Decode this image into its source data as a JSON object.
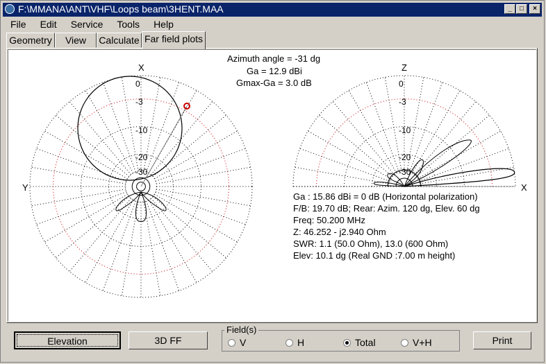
{
  "window": {
    "title": "F:\\MMANA\\ANT\\VHF\\Loops beam\\3HENT.MAA",
    "min_label": "_",
    "max_label": "□",
    "close_label": "×"
  },
  "menu": [
    "File",
    "Edit",
    "Service",
    "Tools",
    "Help"
  ],
  "tabs": [
    "Geometry",
    "View",
    "Calculate",
    "Far field plots"
  ],
  "active_tab": 3,
  "header": {
    "azimuth": "Azimuth angle = -31 dg",
    "ga": "Ga = 12.9 dBi",
    "gmax": "Gmax-Ga = 3.0 dB"
  },
  "azimuth_plot": {
    "top_label": "X",
    "left_label": "Y",
    "ring_labels": [
      "0",
      "-3",
      "-10",
      "-20",
      "-30"
    ]
  },
  "elevation_plot": {
    "top_label": "Z",
    "right_label": "X",
    "ring_labels": [
      "0",
      "-3",
      "-10",
      "-20",
      "-30"
    ]
  },
  "results": [
    "Ga : 15.86 dBi = 0 dB  (Horizontal polarization)",
    "F/B: 19.70 dB; Rear: Azim. 120 dg,  Elev. 60 dg",
    "Freq: 50.200 MHz",
    "Z: 46.252 - j2.940 Ohm",
    "SWR: 1.1 (50.0 Ohm), 13.0 (600 Ohm)",
    "Elev: 10.1 dg (Real GND  :7.00 m height)"
  ],
  "buttons": {
    "elevation": "Elevation",
    "ff3d": "3D FF",
    "print": "Print"
  },
  "field_group": {
    "label": "Field(s)",
    "options": [
      "V",
      "H",
      "Total",
      "V+H"
    ],
    "selected": "Total"
  },
  "colors": {
    "titlebar": "#0a246a",
    "marker": "#cc0000",
    "grid": "#000000",
    "ring_3db": "#cc0000"
  }
}
